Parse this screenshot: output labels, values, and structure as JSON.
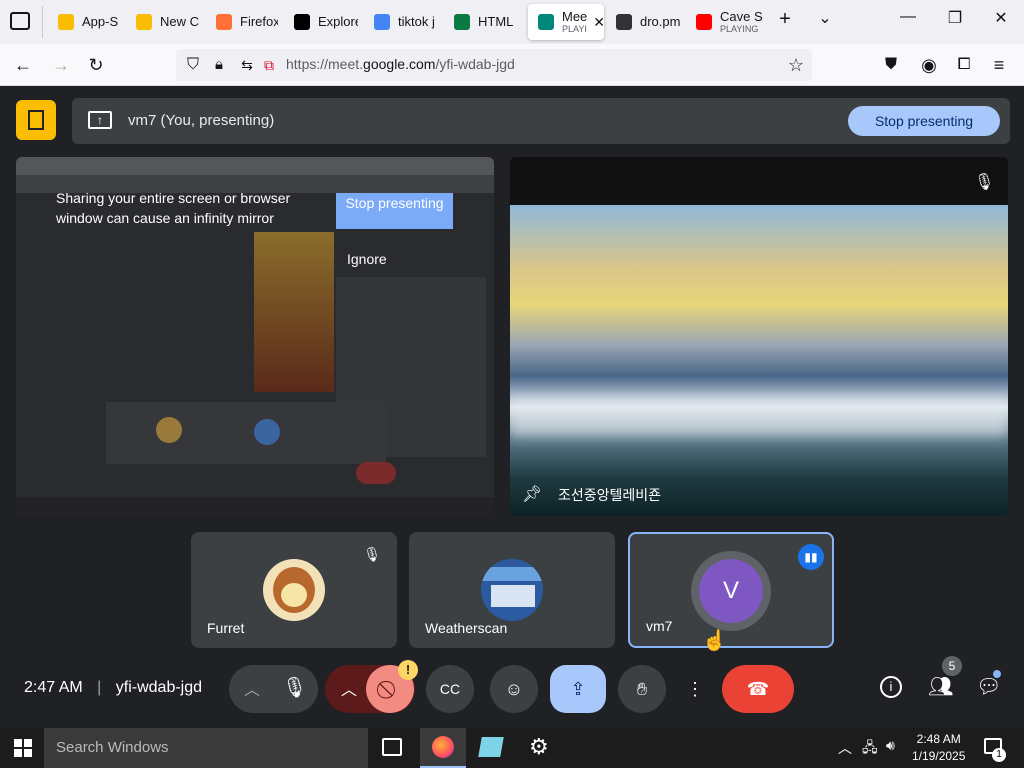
{
  "browser": {
    "tabs": [
      {
        "label": "App-S",
        "sub": "",
        "color": "#fbbc04"
      },
      {
        "label": "New C",
        "sub": "",
        "color": "#fbbc04"
      },
      {
        "label": "Firefox",
        "sub": "",
        "color": "#ff7139"
      },
      {
        "label": "Explore",
        "sub": "",
        "color": "#000000"
      },
      {
        "label": "tiktok j",
        "sub": "",
        "color": "#4285f4"
      },
      {
        "label": "HTML",
        "sub": "",
        "color": "#0a7a43"
      },
      {
        "label": "Mee",
        "sub": "PLAYI",
        "color": "#00897b"
      },
      {
        "label": "dro.pm",
        "sub": "",
        "color": "#333333"
      },
      {
        "label": "Cave S",
        "sub": "PLAYING",
        "color": "#ff0000"
      }
    ],
    "url_prefix": "https://meet.",
    "url_domain": "google.com",
    "url_path": "/yfi-wdab-jgd"
  },
  "meet": {
    "presenting_text": "vm7 (You, presenting)",
    "stop_presenting": "Stop presenting",
    "warning_text": "Sharing your entire screen or browser window can cause an infinity mirror",
    "warning_stop": "Stop presenting",
    "warning_ignore": "Ignore",
    "channel_label": "조선중앙텔레비죤",
    "participants": [
      {
        "name": "Furret"
      },
      {
        "name": "Weatherscan"
      },
      {
        "name": "vm7",
        "initial": "V"
      }
    ],
    "time": "2:47 AM",
    "meeting_code": "yfi-wdab-jgd",
    "people_count": "5"
  },
  "taskbar": {
    "search_placeholder": "Search Windows",
    "time": "2:48 AM",
    "date": "1/19/2025",
    "notification_count": "1"
  }
}
